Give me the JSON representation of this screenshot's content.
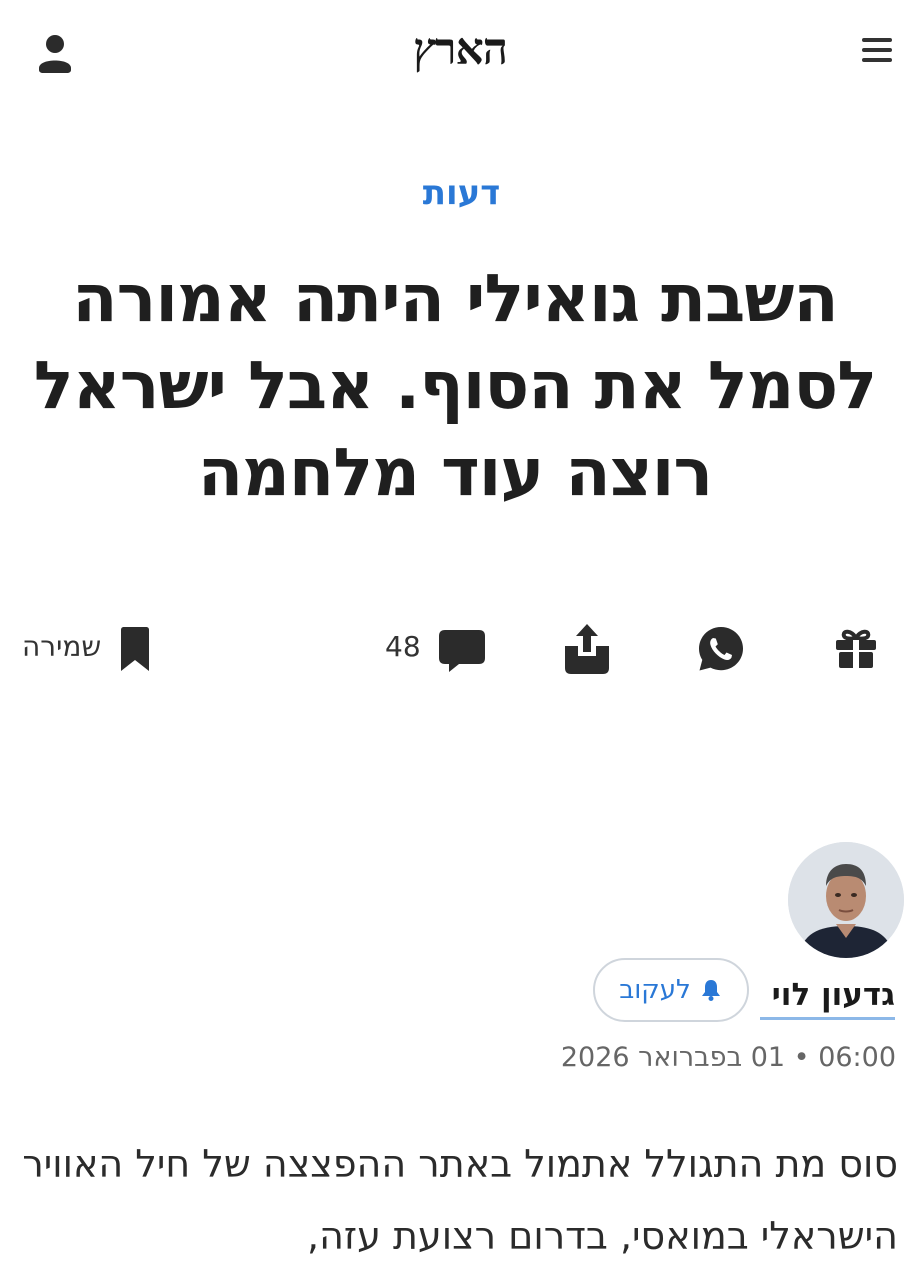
{
  "header": {
    "logo_text": "הארץ",
    "menu_icon": "hamburger-menu-icon",
    "account_icon": "user-icon"
  },
  "article": {
    "section": "דעות",
    "headline": "השבת גואילי היתה אמורה לסמל את הסוף. אבל ישראל רוצה עוד מלחמה",
    "actions": {
      "gift_icon": "gift-icon",
      "whatsapp_icon": "whatsapp-icon",
      "share_icon": "share-icon",
      "comments_count": "48",
      "save_label": "שמירה"
    },
    "author": {
      "name": "גדעון לוי",
      "follow_label": "לעקוב"
    },
    "timestamp": "06:00 • 01 בפברואר 2026",
    "body": "סוס מת התגולל אתמול באתר ההפצצה של חיל האוויר הישראלי במואסי, בדרום רצועת עזה,"
  },
  "colors": {
    "accent": "#2a78d6",
    "text": "#1f1f1f",
    "muted": "#666666"
  }
}
